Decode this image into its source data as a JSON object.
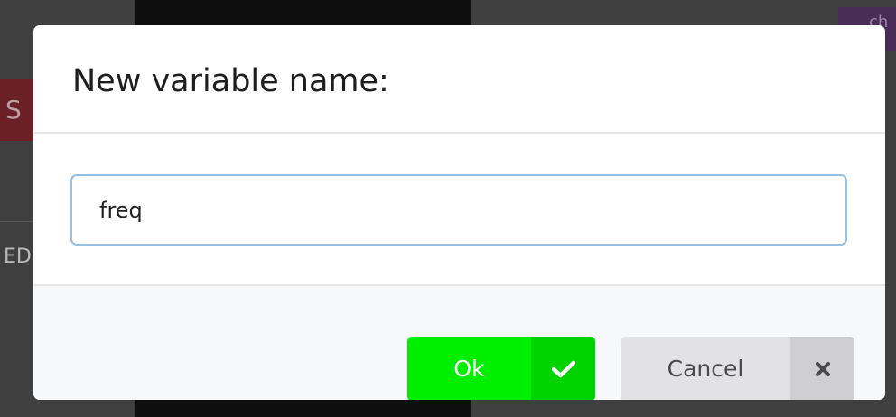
{
  "dialog": {
    "title": "New variable name:",
    "input_value": "freq",
    "ok_label": "Ok",
    "cancel_label": "Cancel",
    "ok_icon": "check-icon",
    "cancel_icon": "close-icon"
  },
  "background": {
    "left_chip_text": "S",
    "left_text": "ED",
    "top_right_chip_text": "ch"
  },
  "colors": {
    "ok_green": "#00ee00",
    "ok_icon_green": "#00d400",
    "cancel_gray": "#e2e2e4",
    "input_border": "#99bfe0"
  }
}
